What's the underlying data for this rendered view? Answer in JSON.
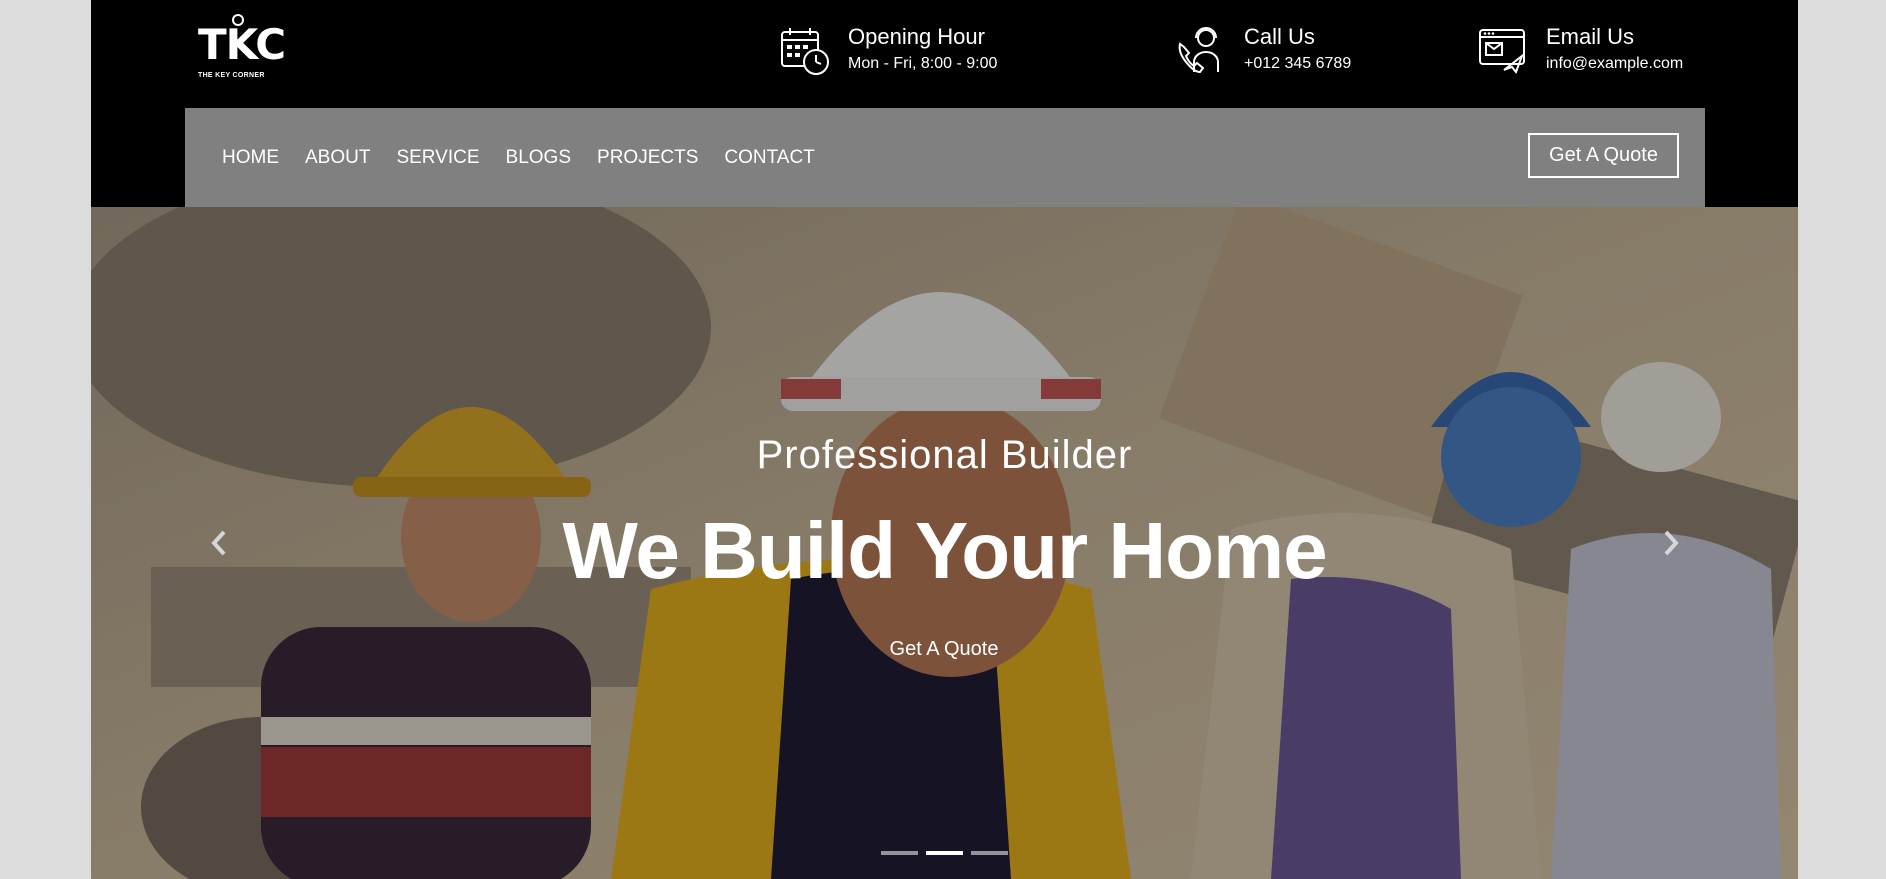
{
  "brand": {
    "logo_text": "TKC",
    "logo_subtext": "THE KEY CORNER"
  },
  "topbar": {
    "opening": {
      "title": "Opening Hour",
      "value": "Mon - Fri, 8:00 - 9:00",
      "icon": "calendar-clock-icon"
    },
    "call": {
      "title": "Call Us",
      "value": "+012 345 6789",
      "icon": "support-agent-icon"
    },
    "email": {
      "title": "Email Us",
      "value": "info@example.com",
      "icon": "email-window-icon"
    }
  },
  "nav": {
    "items": [
      "HOME",
      "ABOUT",
      "SERVICE",
      "BLOGS",
      "PROJECTS",
      "CONTACT"
    ],
    "quote_label": "Get A Quote"
  },
  "hero": {
    "subtitle": "Professional Builder",
    "title": "We Build Your Home",
    "cta": "Get A Quote",
    "active_slide": 2,
    "slide_count": 3
  },
  "colors": {
    "topbar_bg": "#000000",
    "navbar_bg": "#808080",
    "text": "#ffffff"
  }
}
